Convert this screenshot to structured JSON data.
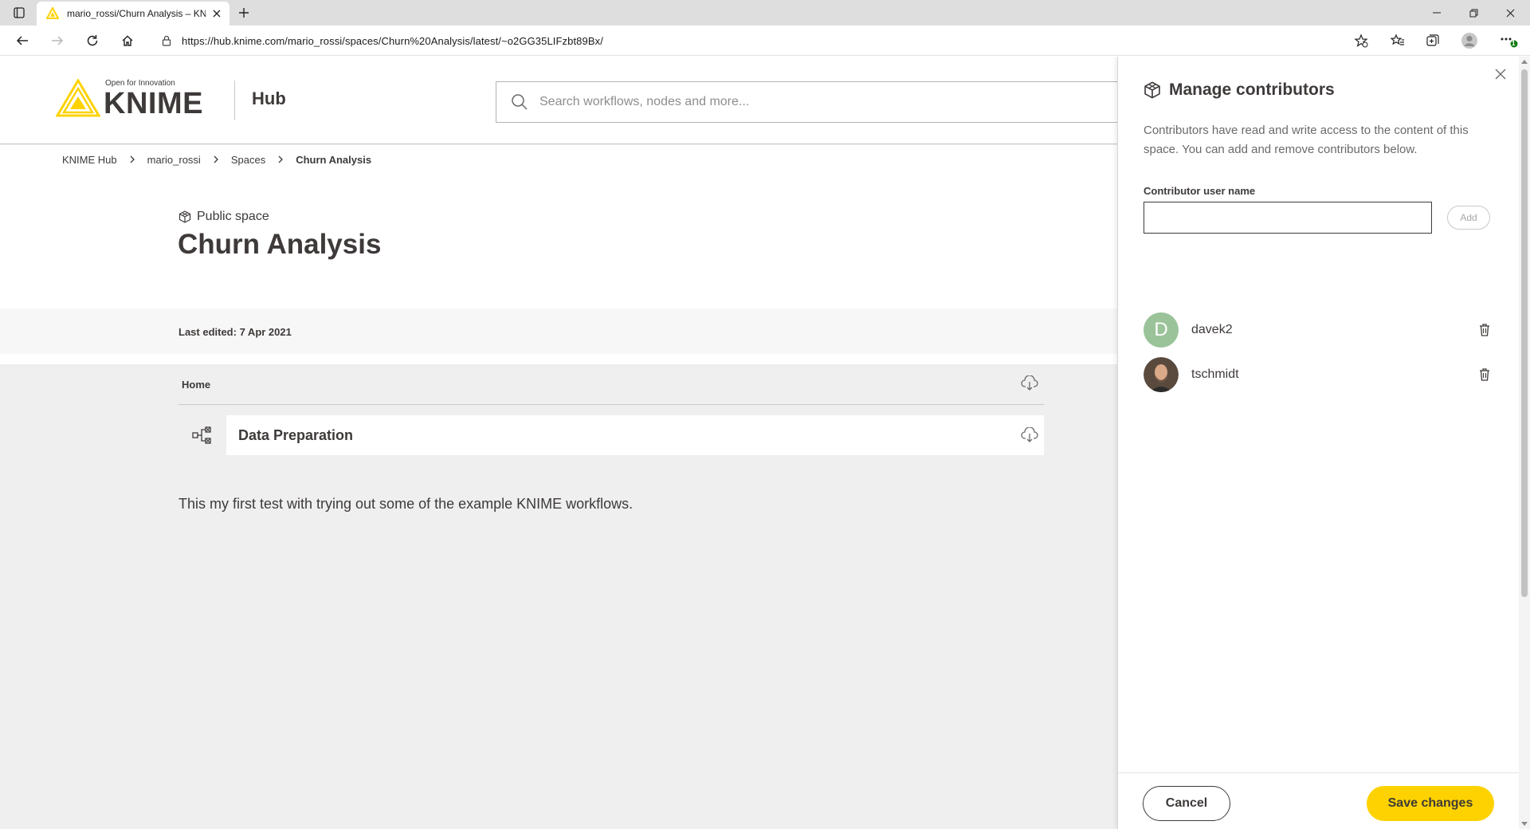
{
  "browser": {
    "tab_title": "mario_rossi/Churn Analysis – KNIME Hub",
    "url_prefix": "https://",
    "url_host": "hub.knime.com",
    "url_path": "/mario_rossi/spaces/Churn%20Analysis/latest/~o2GG35LIFzbt89Bx/",
    "notification_badge": "1"
  },
  "header": {
    "logo_tagline": "Open for Innovation",
    "logo_word": "KNIME",
    "hub_label": "Hub",
    "search_placeholder": "Search workflows, nodes and more..."
  },
  "breadcrumb": {
    "items": [
      "KNIME Hub",
      "mario_rossi",
      "Spaces",
      "Churn Analysis"
    ]
  },
  "space": {
    "type_label": "Public space",
    "title": "Churn Analysis",
    "last_edited": "Last edited: 7 Apr 2021",
    "explorer_header": "Home",
    "items": [
      {
        "name": "Data Preparation",
        "type_icon": "workflow-group-icon"
      }
    ],
    "description": "This my first test with trying out some of the example KNIME workflows."
  },
  "panel": {
    "title": "Manage contributors",
    "description": "Contributors have read and write access to the content of this space. You can add and remove contributors below.",
    "field_label": "Contributor user name",
    "input_value": "",
    "add_label": "Add",
    "contributors": [
      {
        "username": "davek2",
        "initial": "D"
      },
      {
        "username": "tschmidt",
        "initial": ""
      }
    ],
    "cancel_label": "Cancel",
    "save_label": "Save changes"
  },
  "colors": {
    "accent_yellow": "#fdd200",
    "text_dark": "#3e3a39",
    "avatar_green": "#9ac39a"
  }
}
